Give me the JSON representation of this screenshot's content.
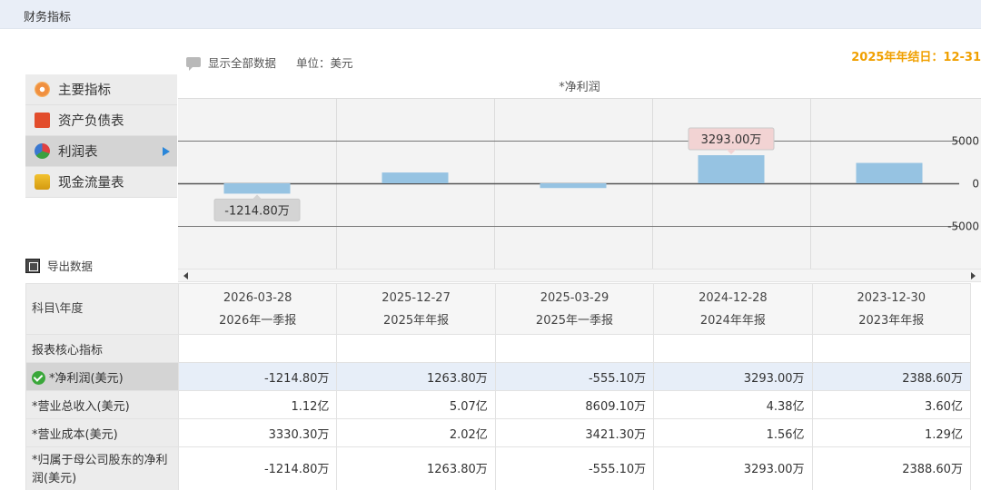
{
  "header": {
    "title": "财务指标"
  },
  "toolbar": {
    "show_all_label": "显示全部数据",
    "unit_label": "单位：美元"
  },
  "year_end": "2025年年结日：12-31",
  "nav": {
    "items": [
      {
        "label": "主要指标",
        "icon": "gear-icon"
      },
      {
        "label": "资产负债表",
        "icon": "document-icon"
      },
      {
        "label": "利润表",
        "icon": "pie-chart-icon",
        "active": true
      },
      {
        "label": "现金流量表",
        "icon": "coins-icon"
      }
    ]
  },
  "export": {
    "label": "导出数据"
  },
  "chart_data": {
    "type": "bar",
    "title": "*净利润",
    "categories": [
      "2026-03-28",
      "2025-12-27",
      "2025-03-29",
      "2024-12-28",
      "2023-12-30"
    ],
    "values": [
      -1214.8,
      1263.8,
      -555.1,
      3293.0,
      2388.6
    ],
    "ylim": [
      -10000,
      10000
    ],
    "yticks": [
      5000,
      0,
      -5000
    ],
    "tick_labels": [
      "5000",
      "0",
      "-5000"
    ],
    "bar_color": "#96c3e2",
    "tooltips": [
      {
        "category_index": 0,
        "text": "-1214.80万",
        "color": "#d4d4d4"
      },
      {
        "category_index": 3,
        "text": "3293.00万",
        "color": "#f2d3d3"
      }
    ]
  },
  "table": {
    "corner_label": "科目\\年度",
    "columns": [
      {
        "date": "2026-03-28",
        "period": "2026年一季报"
      },
      {
        "date": "2025-12-27",
        "period": "2025年年报"
      },
      {
        "date": "2025-03-29",
        "period": "2025年一季报"
      },
      {
        "date": "2024-12-28",
        "period": "2024年年报"
      },
      {
        "date": "2023-12-30",
        "period": "2023年年报"
      }
    ],
    "section_label": "报表核心指标",
    "rows": [
      {
        "label": "*净利润(美元)",
        "values": [
          "-1214.80万",
          "1263.80万",
          "-555.10万",
          "3293.00万",
          "2388.60万"
        ],
        "selected": true
      },
      {
        "label": "*营业总收入(美元)",
        "values": [
          "1.12亿",
          "5.07亿",
          "8609.10万",
          "4.38亿",
          "3.60亿"
        ]
      },
      {
        "label": "*营业成本(美元)",
        "values": [
          "3330.30万",
          "2.02亿",
          "3421.30万",
          "1.56亿",
          "1.29亿"
        ]
      },
      {
        "label": "*归属于母公司股东的净利润(美元)",
        "values": [
          "-1214.80万",
          "1263.80万",
          "-555.10万",
          "3293.00万",
          "2388.60万"
        ]
      }
    ]
  }
}
